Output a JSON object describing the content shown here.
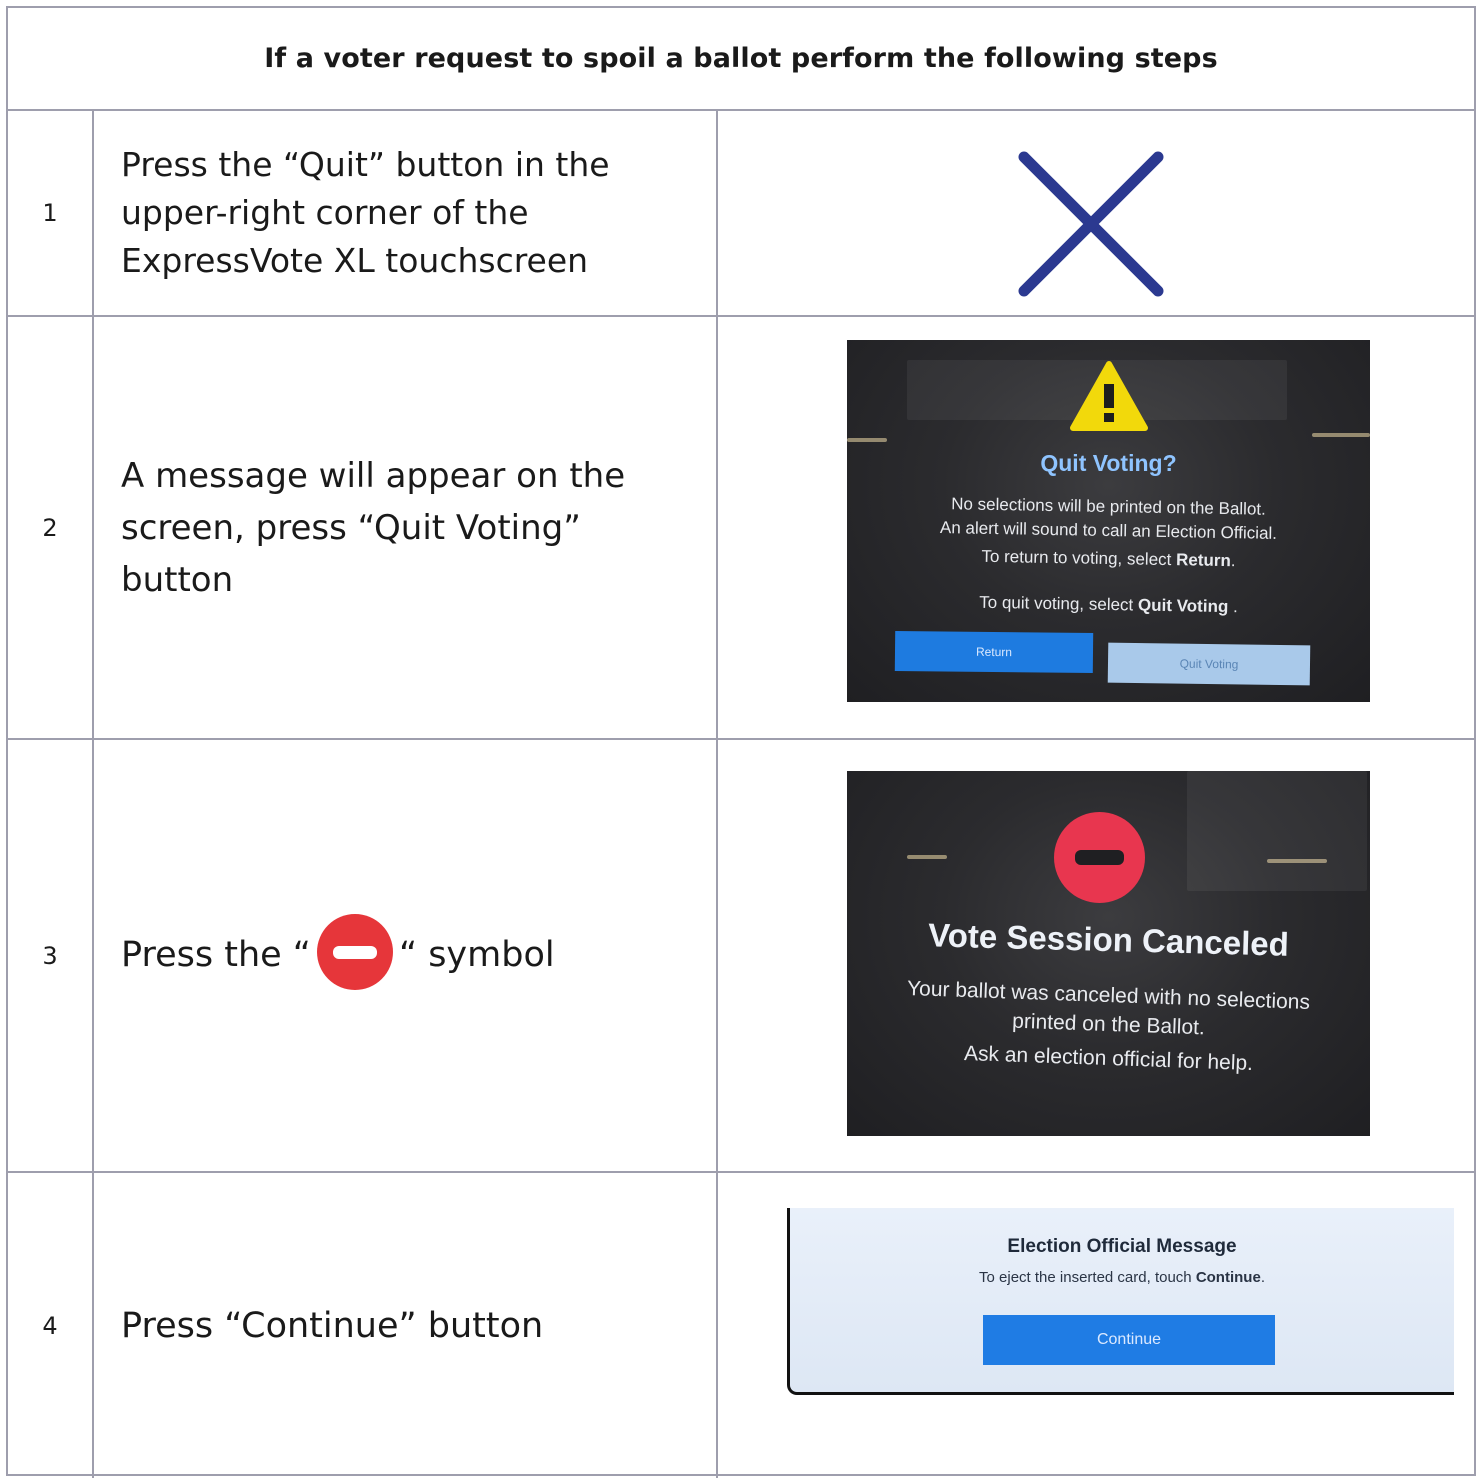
{
  "header": {
    "title": "If a voter request to spoil a ballot perform the following steps"
  },
  "steps": [
    {
      "num": "1",
      "text": "Press the “Quit” button in the upper-right corner of the ExpressVote XL touchscreen",
      "icon": "x-icon"
    },
    {
      "num": "2",
      "text": "A message will appear on the screen, press “Quit Voting” button"
    },
    {
      "num": "3",
      "text_before": "Press the “",
      "text_after": "“ symbol",
      "icon": "no-entry-icon"
    },
    {
      "num": "4",
      "text": "Press “Continue” button"
    }
  ],
  "quit_screen": {
    "title": "Quit Voting?",
    "line1": "No selections will be printed on the Ballot.",
    "line2": "An alert will sound to call an Election Official.",
    "line3_prefix": "To return to voting, select ",
    "line3_bold": "Return",
    "line4_prefix": "To quit voting, select ",
    "line4_bold": "Quit Voting",
    "return_label": "Return",
    "quit_label": "Quit Voting"
  },
  "canceled_screen": {
    "title": "Vote Session Canceled",
    "line1": "Your ballot was canceled with no selections",
    "line2": "printed on the Ballot.",
    "line3": "Ask an election official for help."
  },
  "official_screen": {
    "title": "Election Official Message",
    "body_prefix": "To eject the inserted card, touch ",
    "body_bold": "Continue",
    "continue_label": "Continue"
  },
  "colors": {
    "border": "#9e9ead",
    "x_mark": "#2b3990",
    "no_entry": "#e6363a",
    "warning": "#f2d90b",
    "button_blue": "#1e7be0"
  }
}
